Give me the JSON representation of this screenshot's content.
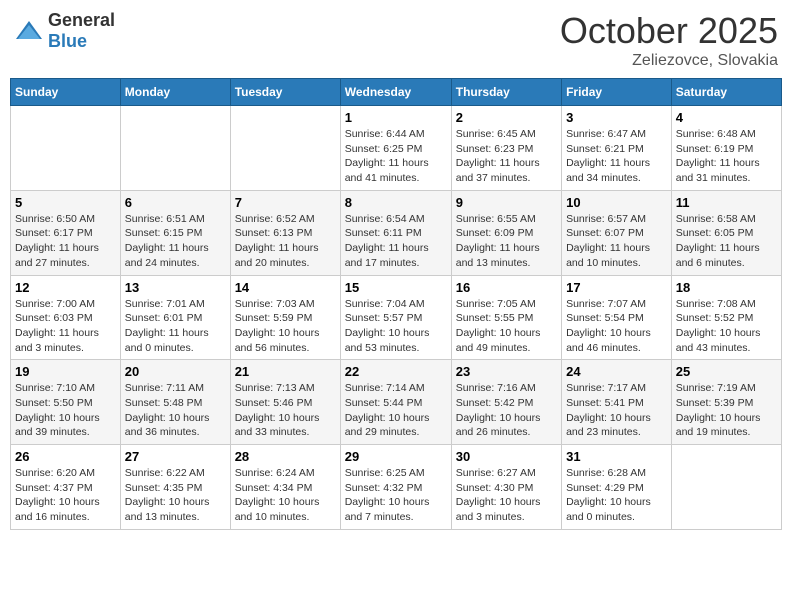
{
  "header": {
    "logo_general": "General",
    "logo_blue": "Blue",
    "month": "October 2025",
    "location": "Zeliezovce, Slovakia"
  },
  "days_of_week": [
    "Sunday",
    "Monday",
    "Tuesday",
    "Wednesday",
    "Thursday",
    "Friday",
    "Saturday"
  ],
  "weeks": [
    [
      {
        "day": "",
        "content": ""
      },
      {
        "day": "",
        "content": ""
      },
      {
        "day": "",
        "content": ""
      },
      {
        "day": "1",
        "content": "Sunrise: 6:44 AM\nSunset: 6:25 PM\nDaylight: 11 hours and 41 minutes."
      },
      {
        "day": "2",
        "content": "Sunrise: 6:45 AM\nSunset: 6:23 PM\nDaylight: 11 hours and 37 minutes."
      },
      {
        "day": "3",
        "content": "Sunrise: 6:47 AM\nSunset: 6:21 PM\nDaylight: 11 hours and 34 minutes."
      },
      {
        "day": "4",
        "content": "Sunrise: 6:48 AM\nSunset: 6:19 PM\nDaylight: 11 hours and 31 minutes."
      }
    ],
    [
      {
        "day": "5",
        "content": "Sunrise: 6:50 AM\nSunset: 6:17 PM\nDaylight: 11 hours and 27 minutes."
      },
      {
        "day": "6",
        "content": "Sunrise: 6:51 AM\nSunset: 6:15 PM\nDaylight: 11 hours and 24 minutes."
      },
      {
        "day": "7",
        "content": "Sunrise: 6:52 AM\nSunset: 6:13 PM\nDaylight: 11 hours and 20 minutes."
      },
      {
        "day": "8",
        "content": "Sunrise: 6:54 AM\nSunset: 6:11 PM\nDaylight: 11 hours and 17 minutes."
      },
      {
        "day": "9",
        "content": "Sunrise: 6:55 AM\nSunset: 6:09 PM\nDaylight: 11 hours and 13 minutes."
      },
      {
        "day": "10",
        "content": "Sunrise: 6:57 AM\nSunset: 6:07 PM\nDaylight: 11 hours and 10 minutes."
      },
      {
        "day": "11",
        "content": "Sunrise: 6:58 AM\nSunset: 6:05 PM\nDaylight: 11 hours and 6 minutes."
      }
    ],
    [
      {
        "day": "12",
        "content": "Sunrise: 7:00 AM\nSunset: 6:03 PM\nDaylight: 11 hours and 3 minutes."
      },
      {
        "day": "13",
        "content": "Sunrise: 7:01 AM\nSunset: 6:01 PM\nDaylight: 11 hours and 0 minutes."
      },
      {
        "day": "14",
        "content": "Sunrise: 7:03 AM\nSunset: 5:59 PM\nDaylight: 10 hours and 56 minutes."
      },
      {
        "day": "15",
        "content": "Sunrise: 7:04 AM\nSunset: 5:57 PM\nDaylight: 10 hours and 53 minutes."
      },
      {
        "day": "16",
        "content": "Sunrise: 7:05 AM\nSunset: 5:55 PM\nDaylight: 10 hours and 49 minutes."
      },
      {
        "day": "17",
        "content": "Sunrise: 7:07 AM\nSunset: 5:54 PM\nDaylight: 10 hours and 46 minutes."
      },
      {
        "day": "18",
        "content": "Sunrise: 7:08 AM\nSunset: 5:52 PM\nDaylight: 10 hours and 43 minutes."
      }
    ],
    [
      {
        "day": "19",
        "content": "Sunrise: 7:10 AM\nSunset: 5:50 PM\nDaylight: 10 hours and 39 minutes."
      },
      {
        "day": "20",
        "content": "Sunrise: 7:11 AM\nSunset: 5:48 PM\nDaylight: 10 hours and 36 minutes."
      },
      {
        "day": "21",
        "content": "Sunrise: 7:13 AM\nSunset: 5:46 PM\nDaylight: 10 hours and 33 minutes."
      },
      {
        "day": "22",
        "content": "Sunrise: 7:14 AM\nSunset: 5:44 PM\nDaylight: 10 hours and 29 minutes."
      },
      {
        "day": "23",
        "content": "Sunrise: 7:16 AM\nSunset: 5:42 PM\nDaylight: 10 hours and 26 minutes."
      },
      {
        "day": "24",
        "content": "Sunrise: 7:17 AM\nSunset: 5:41 PM\nDaylight: 10 hours and 23 minutes."
      },
      {
        "day": "25",
        "content": "Sunrise: 7:19 AM\nSunset: 5:39 PM\nDaylight: 10 hours and 19 minutes."
      }
    ],
    [
      {
        "day": "26",
        "content": "Sunrise: 6:20 AM\nSunset: 4:37 PM\nDaylight: 10 hours and 16 minutes."
      },
      {
        "day": "27",
        "content": "Sunrise: 6:22 AM\nSunset: 4:35 PM\nDaylight: 10 hours and 13 minutes."
      },
      {
        "day": "28",
        "content": "Sunrise: 6:24 AM\nSunset: 4:34 PM\nDaylight: 10 hours and 10 minutes."
      },
      {
        "day": "29",
        "content": "Sunrise: 6:25 AM\nSunset: 4:32 PM\nDaylight: 10 hours and 7 minutes."
      },
      {
        "day": "30",
        "content": "Sunrise: 6:27 AM\nSunset: 4:30 PM\nDaylight: 10 hours and 3 minutes."
      },
      {
        "day": "31",
        "content": "Sunrise: 6:28 AM\nSunset: 4:29 PM\nDaylight: 10 hours and 0 minutes."
      },
      {
        "day": "",
        "content": ""
      }
    ]
  ]
}
